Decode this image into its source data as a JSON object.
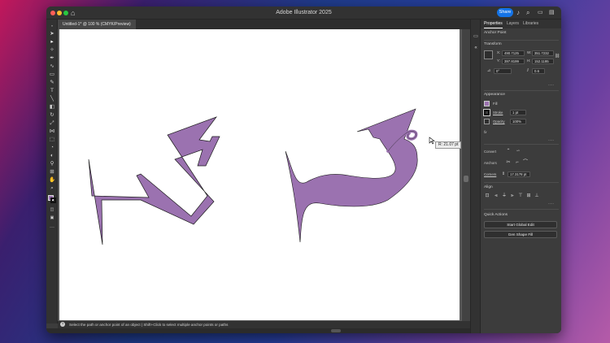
{
  "app": {
    "title": "Adobe Illustrator 2025",
    "share_label": "Share",
    "document_tab": "Untitled-1* @ 100 % (CMYK/Preview)"
  },
  "panel": {
    "tabs": [
      {
        "label": "Properties",
        "active": true
      },
      {
        "label": "Layers",
        "active": false
      },
      {
        "label": "Libraries",
        "active": false
      }
    ],
    "selection_type": "Anchor Point",
    "transform": {
      "heading": "Transform",
      "x_label": "X:",
      "x_value": "490.7125",
      "w_label": "W:",
      "w_value": "351.7232",
      "y_label": "Y:",
      "y_value": "397.8199",
      "h_label": "H:",
      "h_value": "152.1195",
      "angle_value": "0°",
      "shear_value": "0.6"
    },
    "appearance": {
      "heading": "Appearance",
      "fill_label": "Fill",
      "stroke_label": "Stroke",
      "stroke_value": "1 pt",
      "opacity_label": "Opacity",
      "opacity_value": "100%",
      "fx_label": "fx"
    },
    "convert_label": "Convert",
    "anchors_label": "Anchors",
    "corners_label": "Corners",
    "corners_value": "17.3178 pt",
    "align_heading": "Align",
    "quick_actions": {
      "heading": "Quick Actions",
      "start_global_edit": "Start Global Edit",
      "gen_shape_fill": "Gen Shape Fill"
    }
  },
  "canvas": {
    "tooltip": "R: 21.07 pt"
  },
  "status_bar": {
    "hint": "Select the path or anchor point of an object  |  Shift+Click to select multiple anchor points or paths"
  },
  "colors": {
    "shape_fill": "#9b72b0",
    "shape_stroke": "#1a1a1a",
    "share_button": "#1473e6",
    "artboard": "#ffffff"
  },
  "icons": [
    "home-icon",
    "search-icon",
    "bell-icon",
    "panel-toggle-icon",
    "selection-tool-icon",
    "direct-selection-tool-icon",
    "pen-tool-icon",
    "type-tool-icon",
    "rectangle-tool-icon",
    "gear-icon",
    "comment-icon"
  ]
}
